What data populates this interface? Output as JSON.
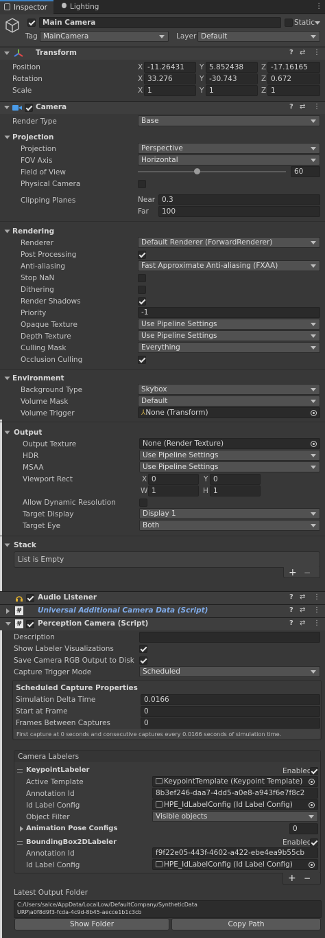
{
  "tabs": {
    "inspector": "Inspector",
    "lighting": "Lighting"
  },
  "header": {
    "name": "Main Camera",
    "static_label": "Static",
    "tag_label": "Tag",
    "tag_value": "MainCamera",
    "layer_label": "Layer",
    "layer_value": "Default"
  },
  "transform": {
    "title": "Transform",
    "position_label": "Position",
    "rotation_label": "Rotation",
    "scale_label": "Scale",
    "position": {
      "x": "-11.26431",
      "y": "5.852438",
      "z": "-17.16165"
    },
    "rotation": {
      "x": "33.276",
      "y": "-30.743",
      "z": "0.672"
    },
    "scale": {
      "x": "1",
      "y": "1",
      "z": "1"
    },
    "axis": {
      "x": "X",
      "y": "Y",
      "z": "Z"
    }
  },
  "camera": {
    "title": "Camera",
    "render_type_label": "Render Type",
    "render_type": "Base",
    "projection_header": "Projection",
    "projection_label": "Projection",
    "projection": "Perspective",
    "fov_axis_label": "FOV Axis",
    "fov_axis": "Horizontal",
    "fov_label": "Field of View",
    "fov": "60",
    "fov_slider_fraction": 0.4,
    "physical_label": "Physical Camera",
    "clipping_label": "Clipping Planes",
    "near_label": "Near",
    "near": "0.3",
    "far_label": "Far",
    "far": "100",
    "rendering_header": "Rendering",
    "renderer_label": "Renderer",
    "renderer": "Default Renderer (ForwardRenderer)",
    "post_label": "Post Processing",
    "aa_label": "Anti-aliasing",
    "aa": "Fast Approximate Anti-aliasing (FXAA)",
    "stopnan_label": "Stop NaN",
    "dither_label": "Dithering",
    "shadows_label": "Render Shadows",
    "priority_label": "Priority",
    "priority": "-1",
    "opaque_label": "Opaque Texture",
    "opaque": "Use Pipeline Settings",
    "depth_label": "Depth Texture",
    "depth": "Use Pipeline Settings",
    "culling_label": "Culling Mask",
    "culling": "Everything",
    "occlusion_label": "Occlusion Culling",
    "environment_header": "Environment",
    "bg_label": "Background Type",
    "bg": "Skybox",
    "volmask_label": "Volume Mask",
    "volmask": "Default",
    "voltrig_label": "Volume Trigger",
    "voltrig": "None (Transform)",
    "output_header": "Output",
    "outtex_label": "Output Texture",
    "outtex": "None (Render Texture)",
    "hdr_label": "HDR",
    "hdr": "Use Pipeline Settings",
    "msaa_label": "MSAA",
    "msaa": "Use Pipeline Settings",
    "viewport_label": "Viewport Rect",
    "vx_label": "X",
    "vx": "0",
    "vy_label": "Y",
    "vy": "0",
    "vw_label": "W",
    "vw": "1",
    "vh_label": "H",
    "vh": "1",
    "dynres_label": "Allow Dynamic Resolution",
    "target_display_label": "Target Display",
    "target_display": "Display 1",
    "target_eye_label": "Target Eye",
    "target_eye": "Both",
    "stack_header": "Stack",
    "stack_empty": "List is Empty"
  },
  "audio": {
    "title": "Audio Listener"
  },
  "urp": {
    "title": "Universal Additional Camera Data (Script)"
  },
  "perception": {
    "title": "Perception Camera (Script)",
    "description_label": "Description",
    "show_labeler_label": "Show Labeler Visualizations",
    "save_rgb_label": "Save Camera RGB Output to Disk",
    "trigger_label": "Capture Trigger Mode",
    "trigger": "Scheduled",
    "scheduled_header": "Scheduled Capture Properties",
    "delta_label": "Simulation Delta Time",
    "delta": "0.0166",
    "start_label": "Start at Frame",
    "start": "0",
    "between_label": "Frames Between Captures",
    "between": "0",
    "info": "First capture at 0 seconds and consecutive captures every 0.0166 seconds of simulation time.",
    "labelers_header": "Camera Labelers",
    "enabled_label": "Enabled",
    "kp_title": "KeypointLabeler",
    "kp_template_label": "Active Template",
    "kp_template": "KeypointTemplate (Keypoint Template)",
    "kp_annot_label": "Annotation Id",
    "kp_annot": "8b3ef246-daa7-4dd5-a0e8-a943f6e7f8c2",
    "kp_idlabel_label": "Id Label Config",
    "kp_idlabel": "HPE_IdLabelConfig (Id Label Config)",
    "kp_filter_label": "Object Filter",
    "kp_filter": "Visible objects",
    "kp_pose_label": "Animation Pose Configs",
    "kp_pose": "0",
    "bb_title": "BoundingBox2DLabeler",
    "bb_annot_label": "Annotation Id",
    "bb_annot": "f9f22e05-443f-4602-a422-ebe4ea9b55cb",
    "bb_idlabel_label": "Id Label Config",
    "bb_idlabel": "HPE_IdLabelConfig (Id Label Config)",
    "folder_label": "Latest Output Folder",
    "folder_line1": "C:/Users/salce/AppData/LocalLow/DefaultCompany/SyntheticData",
    "folder_line2": "URP\\a0f8d9f3-fcda-4c9d-8b45-aecce1b1c3cb",
    "show_folder": "Show Folder",
    "copy_path": "Copy Path"
  },
  "glyphs": {
    "plus": "+",
    "minus": "−",
    "help": "?",
    "settings": "⇄",
    "more": "⋮"
  },
  "colors": {
    "bg": "#383838",
    "field": "#2a2a2a",
    "link": "#7ea9e6",
    "accent": "#3b82c4"
  },
  "icons": [
    "cube-icon",
    "transform-icon",
    "camera-icon",
    "audio-listener-icon",
    "script-icon",
    "help-icon",
    "preset-icon",
    "more-icon"
  ]
}
